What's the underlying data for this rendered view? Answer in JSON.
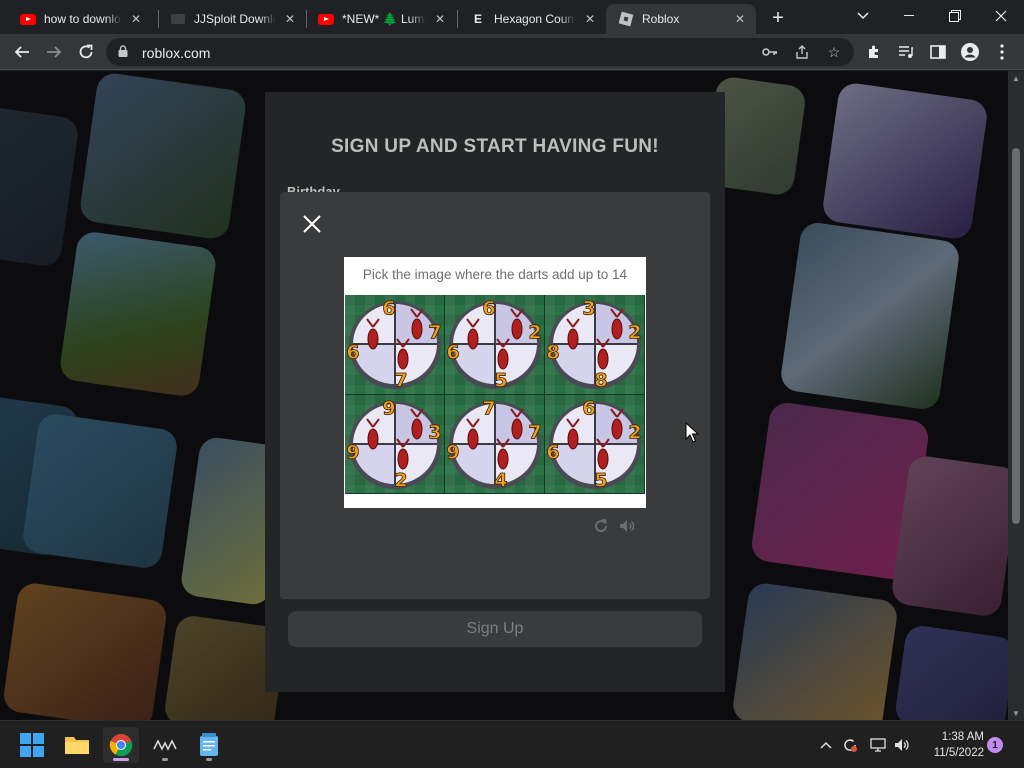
{
  "browser": {
    "tabs": [
      {
        "title": "how to download",
        "favicon": "youtube-icon"
      },
      {
        "title": "JJSploit Download",
        "favicon": "jjsploit-icon"
      },
      {
        "title": "*NEW* 🌲 Lumb",
        "favicon": "youtube-icon"
      },
      {
        "title": "Hexagon County",
        "favicon": "hexagon-icon"
      },
      {
        "title": "Roblox",
        "favicon": "roblox-icon",
        "active": true
      }
    ],
    "url": "roblox.com"
  },
  "page": {
    "signup_title": "SIGN UP AND START HAVING FUN!",
    "birthday_label": "Birthday",
    "signup_button": "Sign Up"
  },
  "captcha": {
    "prompt": "Pick the image where the darts add up to 14",
    "options": [
      {
        "numbers": [
          "6",
          "7",
          "6",
          "7"
        ]
      },
      {
        "numbers": [
          "6",
          "2",
          "6",
          "5"
        ]
      },
      {
        "numbers": [
          "3",
          "2",
          "8",
          "8"
        ]
      },
      {
        "numbers": [
          "9",
          "3",
          "9",
          "2"
        ]
      },
      {
        "numbers": [
          "7",
          "7",
          "9",
          "4"
        ]
      },
      {
        "numbers": [
          "6",
          "2",
          "6",
          "5"
        ]
      }
    ],
    "tools": [
      "refresh-icon",
      "audio-icon"
    ]
  },
  "taskbar": {
    "apps": [
      "start-icon",
      "file-explorer-icon",
      "chrome-icon",
      "app-icon",
      "notepad-icon"
    ],
    "time": "1:38 AM",
    "date": "11/5/2022",
    "notification_count": "1"
  },
  "colors": {
    "chrome_dark": "#202124",
    "toolbar": "#35363a",
    "modal": "#393b3d",
    "board_green": "#2b7146",
    "notification": "#c08cf0"
  }
}
